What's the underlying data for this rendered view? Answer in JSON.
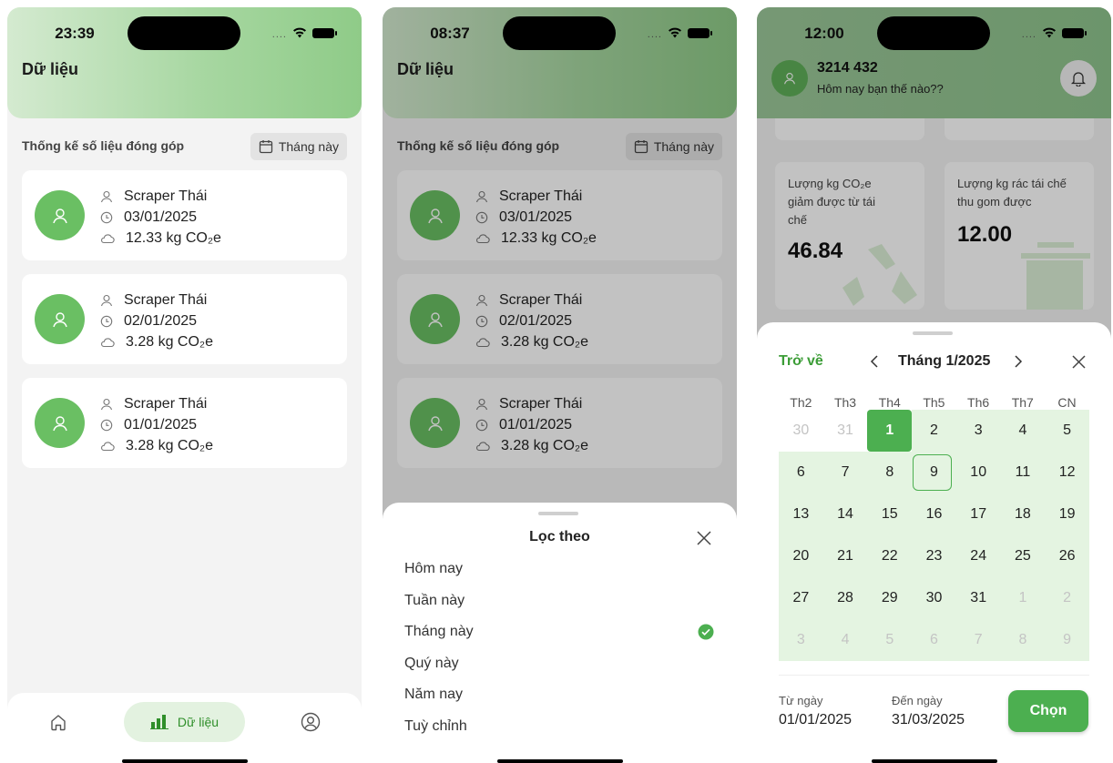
{
  "screen1": {
    "time": "23:39",
    "title": "Dữ liệu",
    "section": "Thống kế số liệu đóng góp",
    "filter_label": "Tháng này",
    "records": [
      {
        "name": "Scraper Thái",
        "date": "03/01/2025",
        "amount": "12.33 kg CO₂e"
      },
      {
        "name": "Scraper Thái",
        "date": "02/01/2025",
        "amount": "3.28 kg CO₂e"
      },
      {
        "name": "Scraper Thái",
        "date": "01/01/2025",
        "amount": "3.28 kg CO₂e"
      }
    ],
    "nav_label": "Dữ liệu"
  },
  "screen2": {
    "time": "08:37",
    "title": "Dữ liệu",
    "section": "Thống kế số liệu đóng góp",
    "filter_label": "Tháng này",
    "records": [
      {
        "name": "Scraper Thái",
        "date": "03/01/2025",
        "amount": "12.33 kg CO₂e"
      },
      {
        "name": "Scraper Thái",
        "date": "02/01/2025",
        "amount": "3.28 kg CO₂e"
      },
      {
        "name": "Scraper Thái",
        "date": "01/01/2025",
        "amount": "3.28 kg CO₂e"
      }
    ],
    "sheet_title": "Lọc theo",
    "options": [
      "Hôm nay",
      "Tuần này",
      "Tháng này",
      "Quý này",
      "Năm nay",
      "Tuỳ chỉnh"
    ],
    "selected_option": "Tháng này"
  },
  "screen3": {
    "time": "12:00",
    "user_id": "3214 432",
    "greeting": "Hôm nay bạn thế nào??",
    "stat1_label": "Lượng kg CO₂e giảm được từ tái chế",
    "stat1_value": "46.84",
    "stat2_label": "Lượng kg rác tái chế thu gom được",
    "stat2_value": "12.00",
    "back_label": "Trở về",
    "month_label": "Tháng 1/2025",
    "weekdays": [
      "Th2",
      "Th3",
      "Th4",
      "Th5",
      "Th6",
      "Th7",
      "CN"
    ],
    "weeks": [
      [
        "30",
        "31",
        "1",
        "2",
        "3",
        "4",
        "5"
      ],
      [
        "6",
        "7",
        "8",
        "9",
        "10",
        "11",
        "12"
      ],
      [
        "13",
        "14",
        "15",
        "16",
        "17",
        "18",
        "19"
      ],
      [
        "20",
        "21",
        "22",
        "23",
        "24",
        "25",
        "26"
      ],
      [
        "27",
        "28",
        "29",
        "30",
        "31",
        "1",
        "2"
      ],
      [
        "3",
        "4",
        "5",
        "6",
        "7",
        "8",
        "9"
      ]
    ],
    "from_label": "Từ ngày",
    "from_value": "01/01/2025",
    "to_label": "Đến ngày",
    "to_value": "31/03/2025",
    "choose_label": "Chọn"
  },
  "colors": {
    "accent": "#4caf50",
    "light_green": "#e4f4e1"
  }
}
